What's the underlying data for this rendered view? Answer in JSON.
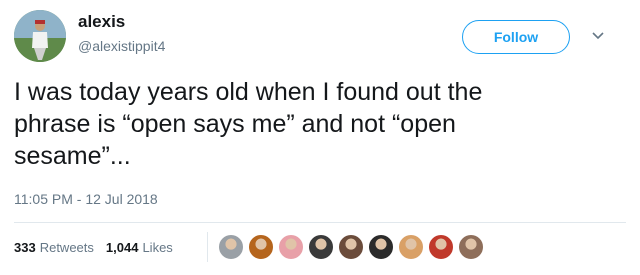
{
  "user": {
    "name": "alexis",
    "handle": "@alexistippit4"
  },
  "actions": {
    "follow_label": "Follow",
    "caret_icon": "chevron-down-icon"
  },
  "tweet": {
    "text_line1": "I was today years old when I found out the",
    "text_line2": "phrase is “open says me” and not “open",
    "text_line3": "sesame”...",
    "timestamp": "11:05 PM - 12 Jul 2018"
  },
  "stats": {
    "retweets_count": "333",
    "retweets_label": "Retweets",
    "likes_count": "1,044",
    "likes_label": "Likes"
  },
  "likers": [
    {
      "color": "#9aa0a6"
    },
    {
      "color": "#b5651d"
    },
    {
      "color": "#e8a0a8"
    },
    {
      "color": "#3a3a3a"
    },
    {
      "color": "#6b4c3b"
    },
    {
      "color": "#2b2b2b"
    },
    {
      "color": "#d9a066"
    },
    {
      "color": "#c0392b"
    },
    {
      "color": "#8e6e5a"
    }
  ],
  "colors": {
    "accent": "#1da1f2",
    "secondary_text": "#657786",
    "primary_text": "#14171a"
  }
}
